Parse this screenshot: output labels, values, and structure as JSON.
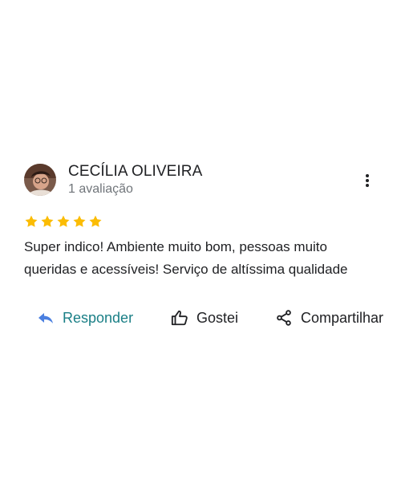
{
  "review": {
    "author_name": "CECÍLIA OLIVEIRA",
    "author_meta": "1 avaliação",
    "rating": 5,
    "rating_max": 5,
    "star_color": "#fbbc04",
    "text": "Super indico! Ambiente muito bom, pessoas muito queridas e acessíveis! Serviço de altíssima qualidade"
  },
  "actions": {
    "reply_label": "Responder",
    "like_label": "Gostei",
    "share_label": "Compartilhar"
  },
  "icons": {
    "menu": "more-vert-icon",
    "reply": "reply-arrow-icon",
    "like": "thumb-up-icon",
    "share": "share-icon"
  },
  "colors": {
    "reply_accent": "#1a7f86",
    "reply_icon": "#4a7fe0",
    "text_primary": "#202124",
    "text_secondary": "#70757a"
  }
}
